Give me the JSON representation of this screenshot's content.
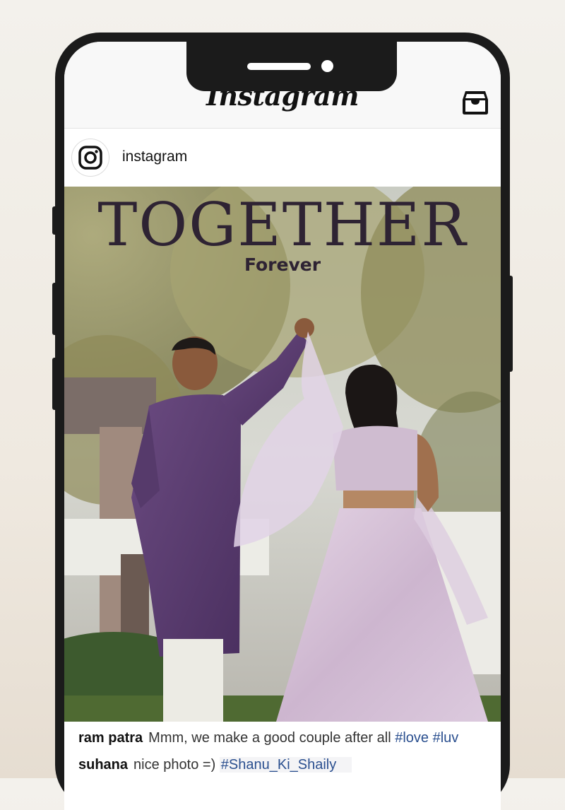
{
  "app": {
    "title": "Instagram"
  },
  "account": {
    "username": "instagram"
  },
  "post": {
    "headline": "TOGETHER",
    "subheadline": "Forever"
  },
  "comments": [
    {
      "user": "ram patra",
      "text": "Mmm, we make a good couple after all",
      "tags": "#love #luv"
    },
    {
      "user": "suhana",
      "text": "nice photo =)",
      "tags": "#Shanu_Ki_Shaily"
    }
  ],
  "colors": {
    "frame": "#1b1b1b",
    "headline": "#2e2333",
    "hashtag": "#2a4f8f",
    "kurta": "#5b3b6e",
    "lehenga": "#d9c6da"
  },
  "icons": [
    "inbox-icon",
    "instagram-logo-icon"
  ]
}
